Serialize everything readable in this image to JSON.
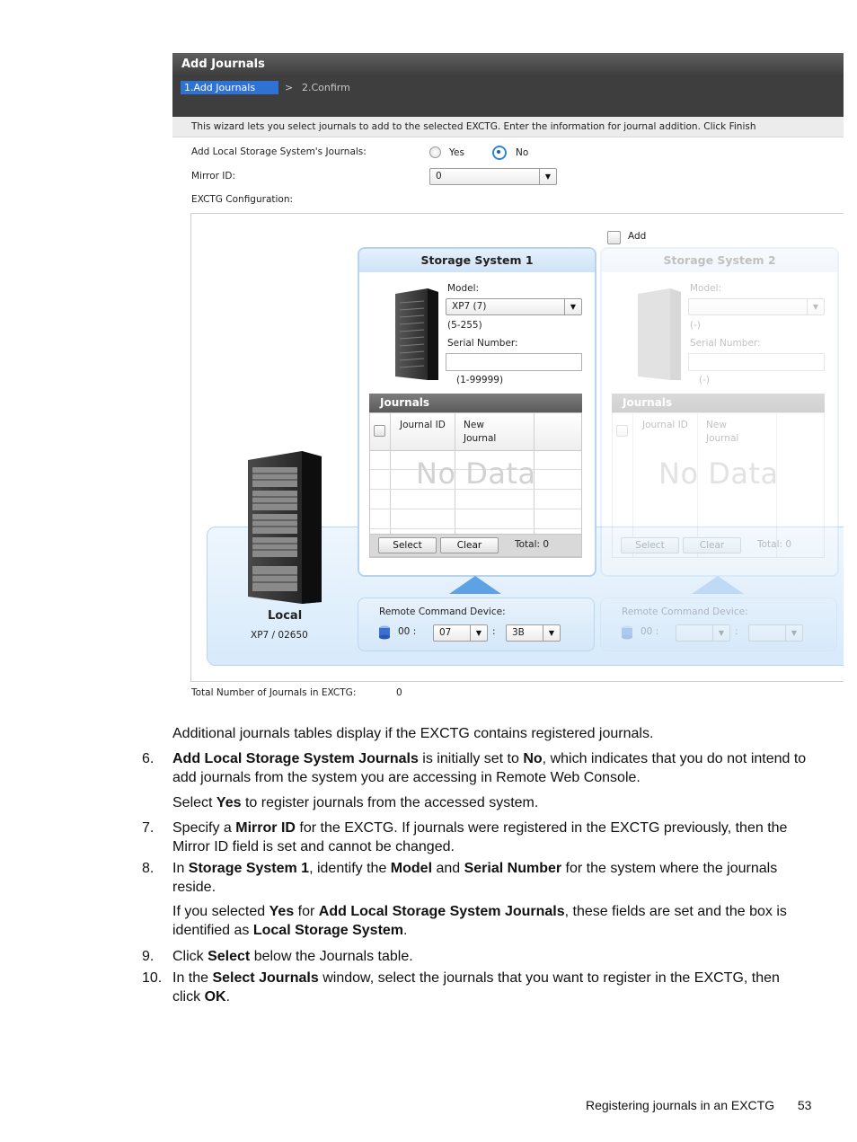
{
  "dialog": {
    "title": "Add Journals",
    "steps": {
      "current": "1.Add Journals",
      "separator": ">",
      "next": "2.Confirm"
    },
    "instruction": "This wizard lets you select journals to add to the selected EXCTG. Enter the information for journal addition. Click Finish",
    "add_local_label": "Add Local Storage System's Journals:",
    "yes_label": "Yes",
    "no_label": "No",
    "mirror_id_label": "Mirror ID:",
    "mirror_id_value": "0",
    "exctg_config_label": "EXCTG Configuration:",
    "add_checkbox_label": "Add",
    "total_label": "Total Number of Journals in EXCTG:",
    "total_value": "0"
  },
  "storage1": {
    "title": "Storage System 1",
    "model_label": "Model:",
    "model_value": "XP7 (7)",
    "model_range": "(5-255)",
    "serial_label": "Serial Number:",
    "serial_value": "",
    "serial_range": "(1-99999)",
    "journals_title": "Journals",
    "col_journal_id": "Journal ID",
    "col_new_journal": "New Journal",
    "no_data": "No Data",
    "select_btn": "Select",
    "clear_btn": "Clear",
    "total": "Total:  0"
  },
  "storage2": {
    "title": "Storage System 2",
    "model_label": "Model:",
    "model_range": "(-)",
    "serial_label": "Serial Number:",
    "serial_range": "(-)",
    "journals_title": "Journals",
    "col_journal_id": "Journal ID",
    "col_new_journal": "New Journal",
    "no_data": "No Data",
    "select_btn": "Select",
    "clear_btn": "Clear",
    "total": "Total:  0"
  },
  "local": {
    "label": "Local",
    "id": "XP7 / 02650"
  },
  "remote1": {
    "label": "Remote Command Device:",
    "prefix": "00 :",
    "ldev1": "07",
    "colon": ":",
    "ldev2": "3B"
  },
  "remote2": {
    "label": "Remote Command Device:",
    "prefix": "00 :",
    "colon": ":"
  },
  "doc": {
    "p_additional": "Additional journals tables display if the EXCTG contains registered journals.",
    "n6": "6.",
    "s6_b1": "Add Local Storage System Journals",
    "s6_t1": " is initially set to ",
    "s6_b2": "No",
    "s6_t2": ", which indicates that you do not intend to add journals from the system you are accessing in Remote Web Console.",
    "s6b_t1": "Select ",
    "s6b_b1": "Yes",
    "s6b_t2": " to register journals from the accessed system.",
    "n7": "7.",
    "s7_t1": "Specify a ",
    "s7_b1": "Mirror ID",
    "s7_t2": " for the EXCTG. If journals were registered in the EXCTG previously, then the Mirror ID field is set and cannot be changed.",
    "n8": "8.",
    "s8_t1": "In ",
    "s8_b1": "Storage System 1",
    "s8_t2": ", identify the ",
    "s8_b2": "Model",
    "s8_t3": " and ",
    "s8_b3": "Serial Number",
    "s8_t4": " for the system where the journals reside.",
    "s8b_t1": "If you selected ",
    "s8b_b1": "Yes",
    "s8b_t2": " for ",
    "s8b_b2": "Add Local Storage System Journals",
    "s8b_t3": ", these fields are set and the box is identified as ",
    "s8b_b3": "Local Storage System",
    "s8b_t4": ".",
    "n9": "9.",
    "s9_t1": "Click ",
    "s9_b1": "Select",
    "s9_t2": " below the Journals table.",
    "n10": "10.",
    "s10_t1": "In the ",
    "s10_b1": "Select Journals",
    "s10_t2": " window, select the journals that you want to register in the EXCTG, then click ",
    "s10_b2": "OK",
    "s10_t3": "."
  },
  "footer": {
    "section": "Registering journals in an EXCTG",
    "page": "53"
  }
}
